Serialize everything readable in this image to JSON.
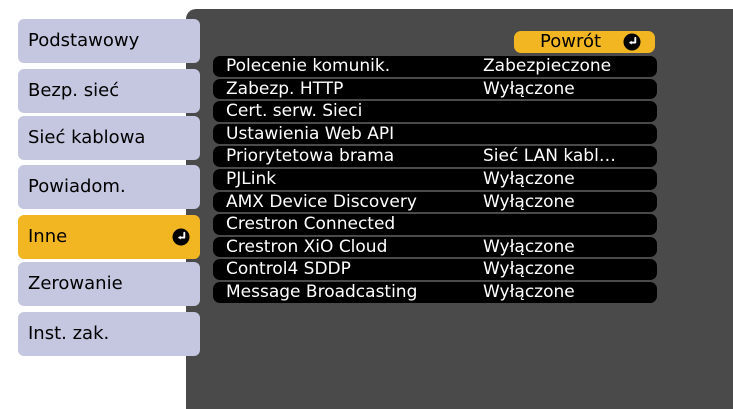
{
  "sidebar": {
    "tabs": [
      {
        "label": "Podstawowy"
      },
      {
        "label": "Bezp. sieć"
      },
      {
        "label": "Sieć kablowa"
      },
      {
        "label": "Powiadom."
      },
      {
        "label": "Inne",
        "active": true
      },
      {
        "label": "Zerowanie"
      },
      {
        "label": "Inst. zak."
      }
    ]
  },
  "main": {
    "back_label": "Powrót",
    "rows": [
      {
        "label": "Polecenie komunik.",
        "value": "Zabezpieczone"
      },
      {
        "label": "Zabezp. HTTP",
        "value": "Wyłączone"
      },
      {
        "label": "Cert. serw. Sieci",
        "value": ""
      },
      {
        "label": "Ustawienia Web API",
        "value": ""
      },
      {
        "label": "Priorytetowa brama",
        "value": "Sieć LAN kabl…"
      },
      {
        "label": "PJLink",
        "value": "Wyłączone"
      },
      {
        "label": "AMX Device Discovery",
        "value": "Wyłączone"
      },
      {
        "label": "Crestron Connected",
        "value": ""
      },
      {
        "label": "Crestron XiO Cloud",
        "value": "Wyłączone"
      },
      {
        "label": "Control4 SDDP",
        "value": "Wyłączone"
      },
      {
        "label": "Message Broadcasting",
        "value": "Wyłączone"
      }
    ]
  },
  "colors": {
    "panel": "#4a4a4a",
    "tab": "#c4c7df",
    "highlight": "#f2b623",
    "row": "#000000"
  },
  "icons": {
    "enter": "enter-return-icon"
  }
}
